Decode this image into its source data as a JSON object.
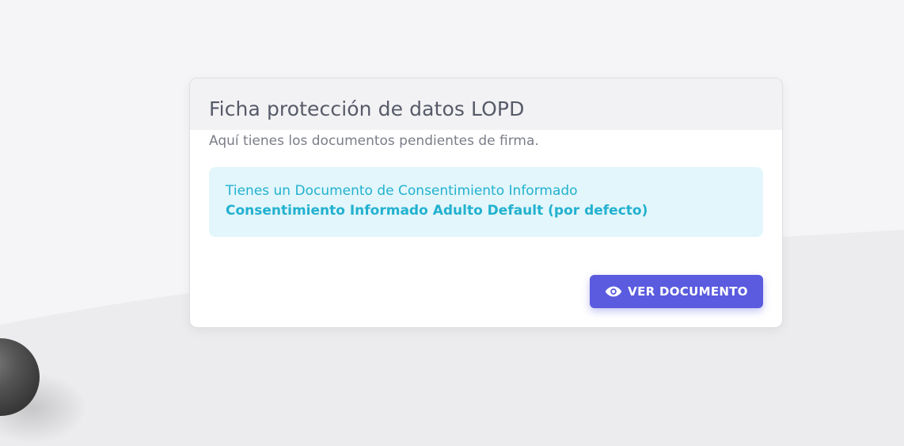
{
  "card": {
    "title": "Ficha protección de datos LOPD",
    "subtitle": "Aquí tienes los documentos pendientes de firma."
  },
  "alert": {
    "line1": "Tienes un Documento de Consentimiento Informado",
    "line2": "Consentimiento Informado Adulto Default (por defecto)"
  },
  "actions": {
    "view_document_label": "VER DOCUMENTO",
    "view_document_icon": "eye-icon"
  },
  "colors": {
    "primary": "#5a5bde",
    "info_text": "#22b1cf",
    "info_bg": "#e2f6fb",
    "background": "#f5f5f7"
  }
}
